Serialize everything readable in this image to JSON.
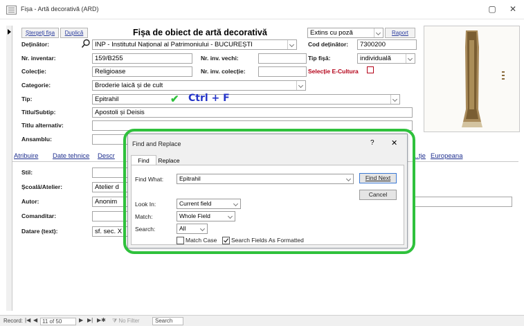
{
  "window": {
    "title": "Fișa - Artă decorativă (ARD)",
    "minimize": "▢",
    "close": "✕"
  },
  "form": {
    "title": "Fișa de obiect de artă decorativă",
    "buttons": {
      "delete": "Ștergeți fișa",
      "duplicate": "Duplică",
      "report": "Raport"
    },
    "view_mode": "Extins cu poză",
    "labels": {
      "owner": "Deținător:",
      "inventory": "Nr. inventar:",
      "collection": "Colecție:",
      "category": "Categorie:",
      "type": "Tip:",
      "title_subtitle": "Titlu/Subtip:",
      "alt_title": "Titlu alternativ:",
      "ensemble": "Ansamblu:",
      "old_inv": "Nr. inv. vechi:",
      "coll_inv": "Nr. inv. colecție:",
      "owner_code": "Cod deținător:",
      "sheet_type": "Tip fișă:",
      "ecultura": "Selecție E-Cultura",
      "style": "Stil:",
      "school": "Școală/Atelier:",
      "author": "Autor:",
      "commissioner": "Comanditar:",
      "dating": "Datare (text):"
    },
    "values": {
      "owner": "INP - Institutul Național al Patrimoniului - BUCUREȘTI",
      "inventory": "159/B255",
      "collection": "Religioase",
      "category": "Broderie laică și de cult",
      "type": "Epitrahil",
      "title_subtitle": "Apostoli și Deisis",
      "owner_code": "7300200",
      "sheet_type": "individuală",
      "school": "Atelier d",
      "author": "Anonim",
      "dating": "sf. sec. X"
    },
    "tabs": [
      "Atribuire",
      "Date tehnice",
      "Descr",
      "...ție",
      "Europeana"
    ],
    "hint": "Ctrl + F"
  },
  "dialog": {
    "title": "Find and Replace",
    "help": "?",
    "close": "✕",
    "tabs": {
      "find": "Find",
      "replace": "Replace"
    },
    "find_what_label": "Find What:",
    "find_what_value": "Epitrahil",
    "find_next": "Find Next",
    "cancel": "Cancel",
    "look_in_label": "Look In:",
    "look_in_value": "Current field",
    "match_label": "Match:",
    "match_value": "Whole Field",
    "search_label": "Search:",
    "search_value": "All",
    "match_case": "Match Case",
    "search_formatted": "Search Fields As Formatted",
    "match_case_checked": false,
    "search_formatted_checked": true
  },
  "navbar": {
    "record_label": "Record:",
    "position": "11 of 50",
    "filter": "No Filter",
    "search": "Search"
  },
  "colors": {
    "highlight": "#2fc13c",
    "check": "#2fc13c",
    "hint": "#2434c8",
    "accent_red": "#b40018"
  }
}
